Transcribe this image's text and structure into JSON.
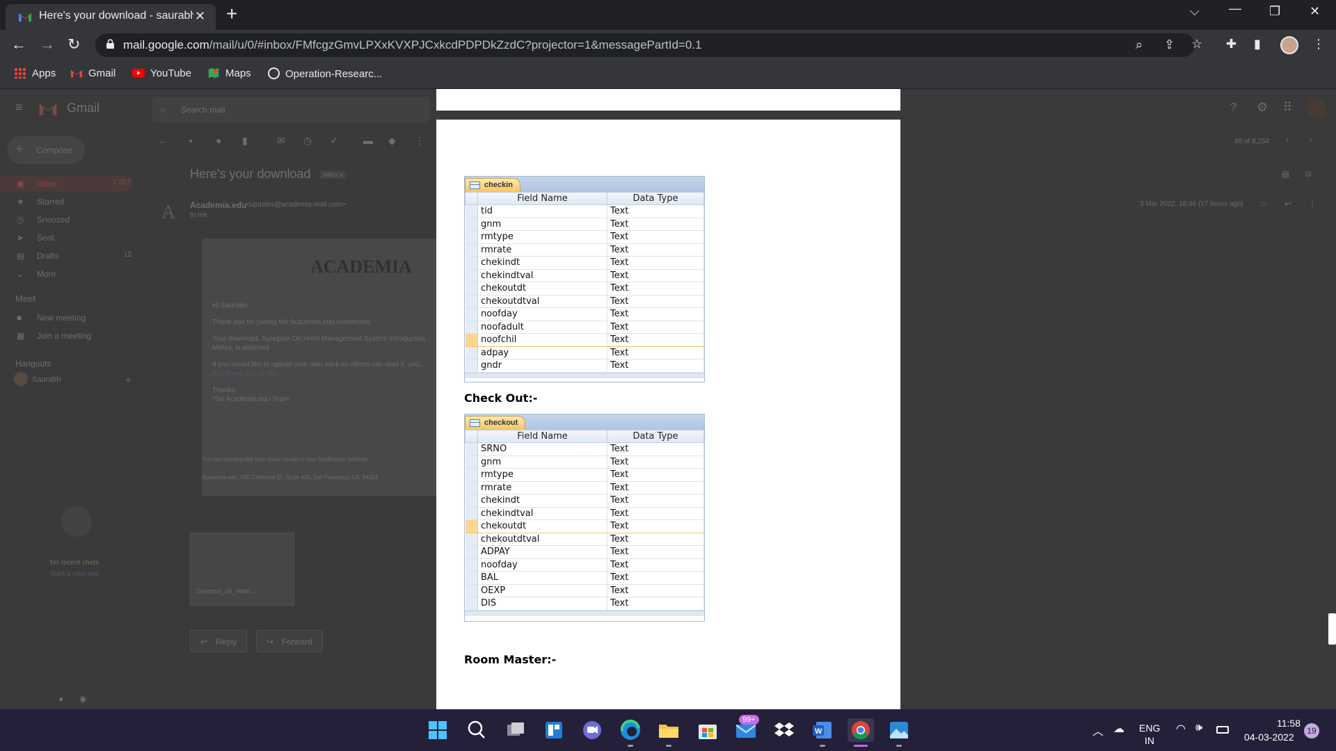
{
  "browser": {
    "tab_title": "Here's your download - saurabhk",
    "url_domain": "mail.google.com",
    "url_path": "/mail/u/0/#inbox/FMfcgzGmvLPXxKVXPJCxkcdPDPDkZzdC?projector=1&messagePartId=0.1",
    "bookmarks": [
      "Apps",
      "Gmail",
      "YouTube",
      "Maps",
      "Operation-Researc..."
    ]
  },
  "gmail": {
    "logo_text": "Gmail",
    "search_placeholder": "Search mail",
    "compose_label": "Compose",
    "nav": [
      {
        "label": "Inbox",
        "count": "7,257"
      },
      {
        "label": "Starred",
        "count": ""
      },
      {
        "label": "Snoozed",
        "count": ""
      },
      {
        "label": "Sent",
        "count": ""
      },
      {
        "label": "Drafts",
        "count": "12"
      },
      {
        "label": "More",
        "count": ""
      }
    ],
    "meet_header": "Meet",
    "meet_items": [
      "New meeting",
      "Join a meeting"
    ],
    "hangouts_header": "Hangouts",
    "hangouts_user": "Saurabh",
    "no_chats": "No recent chats",
    "start_chat": "Start a new one",
    "subject": "Here's your download",
    "inbox_chip": "Inbox x",
    "pagination": "46 of 8,254",
    "sender": "Academia.edu",
    "sender_email": "<updates@academia-mail.com>",
    "to_me": "to me",
    "date": "3 Mar 2022, 18:46 (17 hours ago)",
    "email_logo": "ACADEMIA",
    "email_lines": [
      "Hi Saurabh,",
      "Thank you for joining the Academia.edu community.",
      "Your download, Synopsis On Hotel Management System introduction...",
      "Mehta, is attached.",
      "If you would like to upload your own work so others can read it, you...",
      "Academia.edu profile.",
      "Thanks,",
      "The Academia.edu Team"
    ],
    "footer_lines": [
      "You can unsubscribe from these emails in your Notification Settings.",
      "Academia.edu, 580 California St., Suite 400, San Francisco, CA, 94104"
    ],
    "attachment_name": "Synopsis_on_Hotel...",
    "reply_label": "Reply",
    "forward_label": "Forward"
  },
  "document": {
    "checkin_table": {
      "name": "checkin",
      "headers": [
        "Field Name",
        "Data Type"
      ],
      "rows": [
        [
          "tid",
          "Text"
        ],
        [
          "gnm",
          "Text"
        ],
        [
          "rmtype",
          "Text"
        ],
        [
          "rmrate",
          "Text"
        ],
        [
          "chekindt",
          "Text"
        ],
        [
          "chekindtval",
          "Text"
        ],
        [
          "chekoutdt",
          "Text"
        ],
        [
          "chekoutdtval",
          "Text"
        ],
        [
          "noofday",
          "Text"
        ],
        [
          "noofadult",
          "Text"
        ],
        [
          "noofchil",
          "Text"
        ],
        [
          "adpay",
          "Text"
        ],
        [
          "gndr",
          "Text"
        ]
      ],
      "current_row": 10
    },
    "checkout_heading": "Check Out:-",
    "checkout_table": {
      "name": "checkout",
      "headers": [
        "Field Name",
        "Data Type"
      ],
      "rows": [
        [
          "SRNO",
          "Text"
        ],
        [
          "gnm",
          "Text"
        ],
        [
          "rmtype",
          "Text"
        ],
        [
          "rmrate",
          "Text"
        ],
        [
          "chekindt",
          "Text"
        ],
        [
          "chekindtval",
          "Text"
        ],
        [
          "chekoutdt",
          "Text"
        ],
        [
          "chekoutdtval",
          "Text"
        ],
        [
          "ADPAY",
          "Text"
        ],
        [
          "noofday",
          "Text"
        ],
        [
          "BAL",
          "Text"
        ],
        [
          "OEXP",
          "Text"
        ],
        [
          "DIS",
          "Text"
        ]
      ],
      "current_row": 6
    },
    "room_master_heading": "Room Master:-"
  },
  "taskbar": {
    "mail_badge": "99+",
    "lang_line1": "ENG",
    "lang_line2": "IN",
    "time": "11:58",
    "date": "04-03-2022",
    "notification_count": "19"
  }
}
